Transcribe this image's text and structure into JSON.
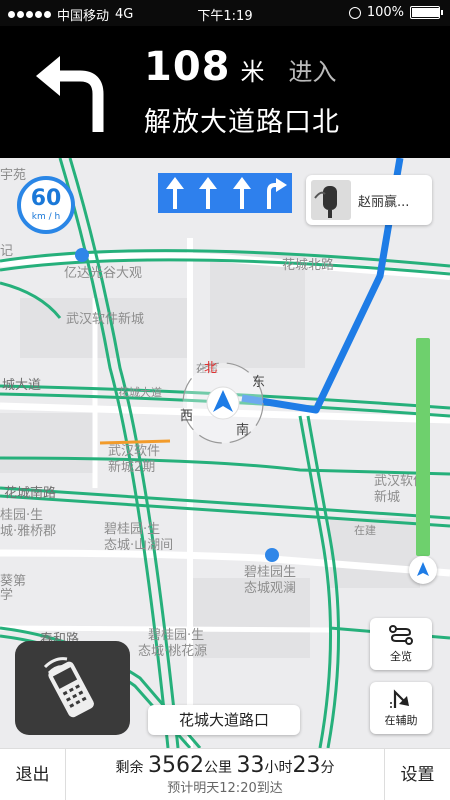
{
  "status_bar": {
    "carrier": "中国移动",
    "network": "4G",
    "time": "下午1:19",
    "battery": "100%",
    "battery_level": 1.0
  },
  "guidance": {
    "turn_icon": "turn-left-icon",
    "distance_value": "108",
    "distance_unit": "米",
    "action": "进入",
    "road_name": "解放大道路口北"
  },
  "map": {
    "speed_limit": "60",
    "speed_unit": "km / h",
    "lanes": [
      "straight-arrow-icon",
      "straight-arrow-icon",
      "straight-arrow-icon",
      "turn-right-arrow-icon"
    ],
    "lane_color": "#2e80ed",
    "music_artist": "赵丽赢...",
    "route_color": "#1e7ce6",
    "compass": {
      "north": "北",
      "east": "东",
      "south": "南",
      "west": "西"
    },
    "labels": {
      "l1": "亿达光谷大观",
      "l2": "花城北路",
      "l3": "武汉软件新城",
      "l4": "城大道",
      "l5": "花城大道",
      "l6": "武汉软件",
      "l7": "新城2期",
      "l8": "武汉软件",
      "l9": "新城",
      "l10": "花城南路",
      "l11": "桂园·生",
      "l12": "城·雅桥郡",
      "l13": "碧桂园·生",
      "l14": "态城·山湖间",
      "l15": "碧桂园生",
      "l16": "态城观澜",
      "l17": "碧桂园·生",
      "l18": "态城·桃花源",
      "l19": "春和路",
      "l20": "在建",
      "l21": "葵第",
      "l22": "学",
      "l23": "宇苑",
      "l24": "记",
      "l25": "在建"
    },
    "overview_label": "全览",
    "side_road_label": "在辅助",
    "current_road": "花城大道路口",
    "route_progress_color": "#6ed06d"
  },
  "bottom_bar": {
    "exit_label": "退出",
    "remain_prefix": "剩余",
    "remain_distance": "3562",
    "distance_unit": "公里",
    "hours": "33",
    "hours_unit": "小时",
    "minutes": "23",
    "minutes_unit": "分",
    "eta": "预计明天12:20到达",
    "settings_label": "设置"
  }
}
